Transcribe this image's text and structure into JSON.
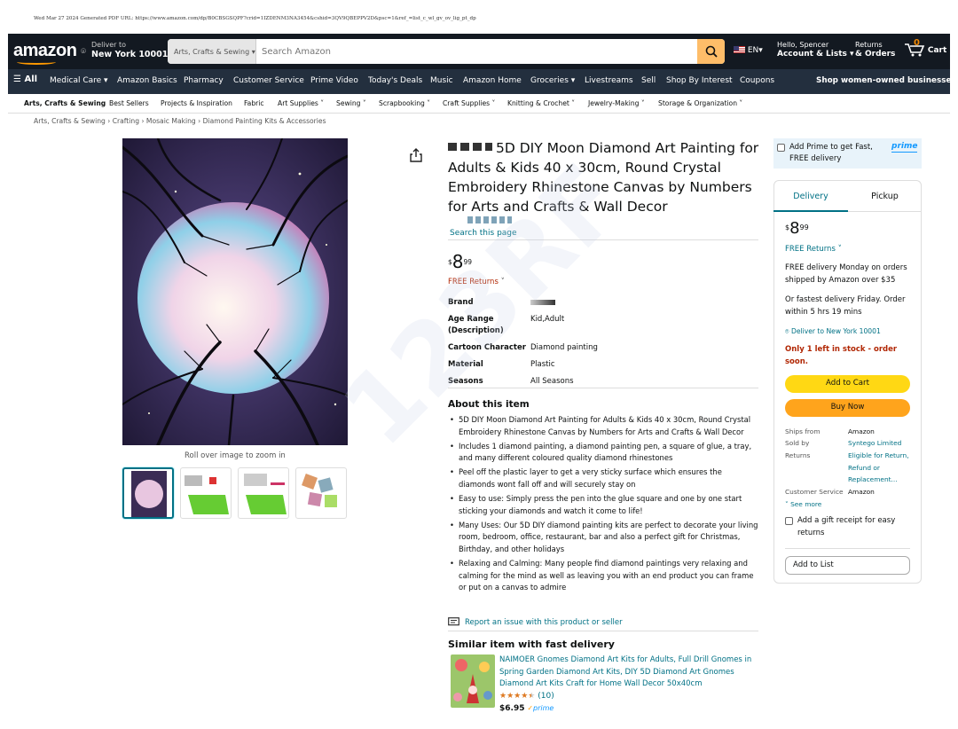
{
  "pdf_header": "Wed Mar 27 2024     Generated PDF URL: https://www.amazon.com/dp/B0CBSGSQPF?crid=1IZDENM3NA3454&cshid=3QV9QBEPPV2D&psc=1&ref_=list_c_wl_gv_ov_lig_pt_dp",
  "nav": {
    "logo": "amazon",
    "deliver_to": "Deliver to",
    "location": "New York 10001",
    "search_category": "Arts, Crafts & Sewing",
    "search_placeholder": "Search Amazon",
    "lang": "EN",
    "account_hello": "Hello, Spencer",
    "account_label": "Account & Lists",
    "returns": "Returns",
    "orders": "& Orders",
    "cart_count": "0",
    "cart_label": "Cart"
  },
  "subnav": {
    "all": "All",
    "items": [
      "Medical Care",
      "Amazon Basics",
      "Pharmacy",
      "Customer Service",
      "Prime Video",
      "Today's Deals",
      "Music",
      "Amazon Home",
      "Groceries",
      "Livestreams",
      "Sell",
      "Shop By Interest",
      "Coupons"
    ],
    "right": "Shop women-owned businesses"
  },
  "catbar": [
    "Arts, Crafts & Sewing",
    "Best Sellers",
    "Projects & Inspiration",
    "Fabric",
    "Art Supplies",
    "Sewing",
    "Scrapbooking",
    "Craft Supplies",
    "Knitting & Crochet",
    "Jewelry-Making",
    "Storage & Organization"
  ],
  "breadcrumb": "Arts, Crafts & Sewing › Crafting › Mosaic Making › Diamond Painting Kits & Accessories",
  "gallery": {
    "rollover": "Roll over image to zoom in"
  },
  "product": {
    "title": "5D DIY Moon Diamond Art Painting for Adults & Kids 40 x 30cm, Round Crystal Embroidery Rhinestone Canvas by Numbers for Arts and Crafts & Wall Decor",
    "search_page": "Search this page",
    "price_symbol": "$",
    "price_whole": "8",
    "price_frac": "99",
    "free_returns": "FREE Returns",
    "specs": [
      {
        "k": "Brand",
        "v": ""
      },
      {
        "k": "Age Range (Description)",
        "v": "Kid,Adult"
      },
      {
        "k": "Cartoon Character",
        "v": "Diamond painting"
      },
      {
        "k": "Material",
        "v": "Plastic"
      },
      {
        "k": "Seasons",
        "v": "All Seasons"
      }
    ],
    "about_heading": "About this item",
    "about": [
      "5D DIY Moon Diamond Art Painting for Adults & Kids 40 x 30cm, Round Crystal Embroidery Rhinestone Canvas by Numbers for Arts and Crafts & Wall Decor",
      "Includes 1 diamond painting, a diamond painting pen, a square of glue, a tray, and many different coloured quality diamond rhinestones",
      "Peel off the plastic layer to get a very sticky surface which ensures the diamonds wont fall off and will securely stay on",
      "Easy to use: Simply press the pen into the glue square and one by one start sticking your diamonds and watch it come to life!",
      "Many Uses: Our 5D DIY diamond painting kits are perfect to decorate your living room, bedroom, office, restaurant, bar and also a perfect gift for Christmas, Birthday, and other holidays",
      "Relaxing and Calming: Many people find diamond paintings very relaxing and calming for the mind as well as leaving you with an end product you can frame or put on a canvas to admire"
    ],
    "report": "Report an issue with this product or seller"
  },
  "similar": {
    "heading": "Similar item with fast delivery",
    "title": "NAIMOER Gnomes Diamond Art Kits for Adults, Full Drill Gnomes in Spring Garden Diamond Art Kits, DIY 5D Diamond Art Gnomes Diamond Art Kits Craft for Home Wall Decor 50x40cm",
    "rating": 4.5,
    "reviews": "(10)",
    "price": "$6.95",
    "prime": "prime"
  },
  "buybox": {
    "prime_text": "Add Prime to get Fast, FREE delivery",
    "prime_logo": "prime",
    "tab_delivery": "Delivery",
    "tab_pickup": "Pickup",
    "free_returns": "FREE Returns",
    "free_delivery": "FREE delivery Monday on orders shipped by Amazon over $35",
    "fastest": "Or fastest delivery Friday. Order within 5 hrs 19 mins",
    "deliver_to": "Deliver to New York 10001",
    "stock": "Only 1 left in stock - order soon.",
    "add_to_cart": "Add to Cart",
    "buy_now": "Buy Now",
    "ships_from_k": "Ships from",
    "ships_from_v": "Amazon",
    "sold_by_k": "Sold by",
    "sold_by_v": "Syntego Limited",
    "returns_k": "Returns",
    "returns_v": "Eligible for Return, Refund or Replacement...",
    "cs_k": "Customer Service",
    "cs_v": "Amazon",
    "see_more": "See more",
    "gift": "Add a gift receipt for easy returns",
    "add_to_list": "Add to List"
  },
  "colors": {
    "nav": "#131921",
    "subnav": "#232f3e",
    "link": "#007185",
    "cart_btn": "#ffd814",
    "buy_btn": "#ffa41c",
    "search_btn": "#febd69"
  }
}
